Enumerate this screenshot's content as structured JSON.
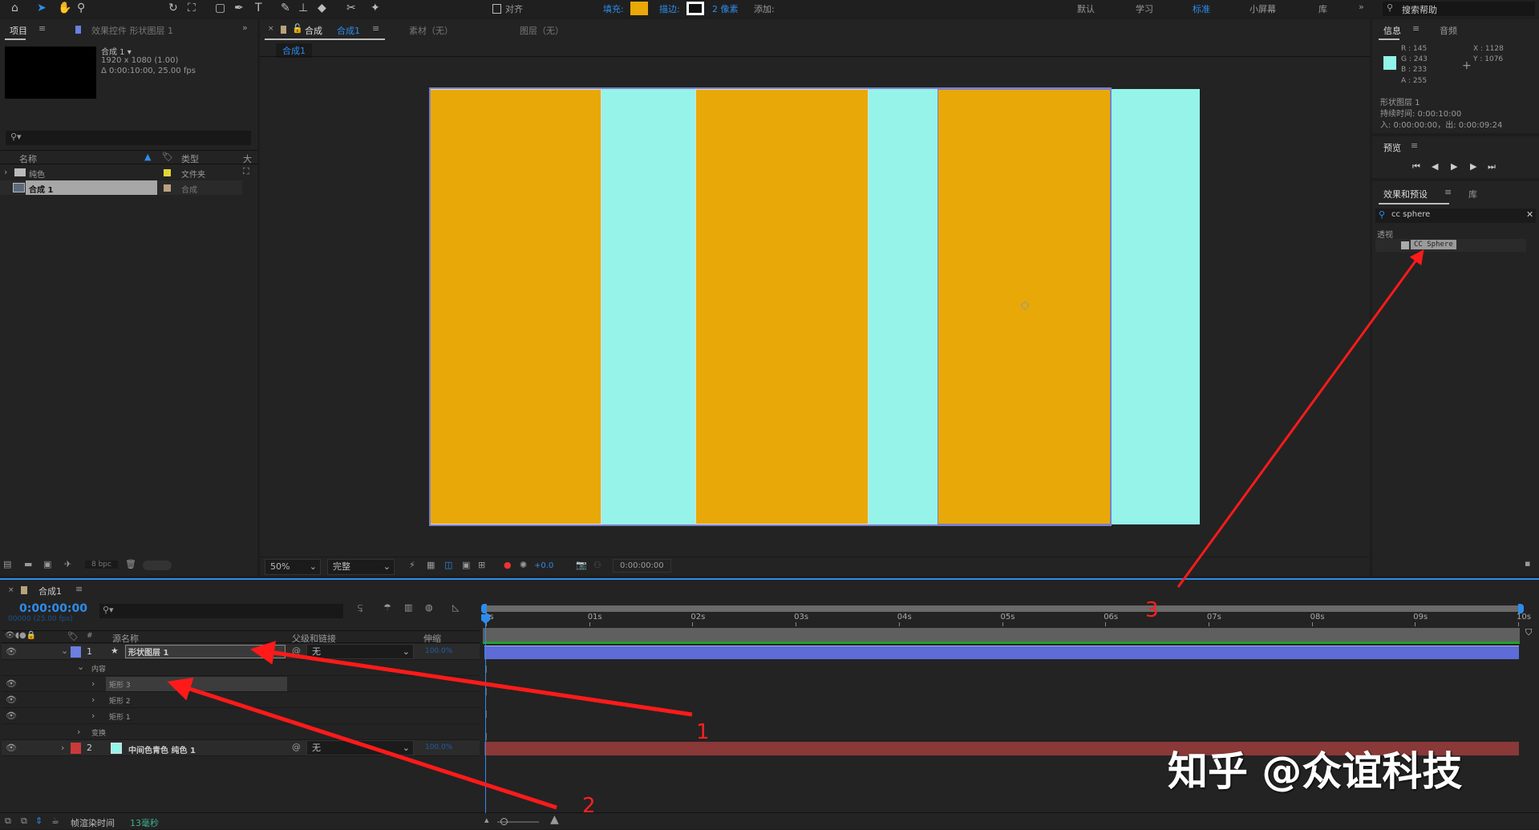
{
  "toolbar": {
    "align_label": "对齐",
    "fill_label": "填充:",
    "stroke_label": "描边:",
    "stroke_width": "2 像素",
    "add_label": "添加:",
    "fill_color": "#e8a807",
    "workspaces": [
      "默认",
      "学习",
      "标准",
      "小屏幕",
      "库"
    ],
    "active_workspace": "标准",
    "search_help": "搜索帮助"
  },
  "project": {
    "tab": "项目",
    "effects_tab": "效果控件 形状图层 1",
    "comp_name": "合成 1 ▾",
    "comp_res": "1920 x 1080 (1.00)",
    "comp_dur": "Δ 0:00:10:00, 25.00 fps",
    "col_name": "名称",
    "col_type": "类型",
    "col_size": "大",
    "items": [
      {
        "name": "纯色",
        "type": "文件夹",
        "label_color": "#e3d43a"
      },
      {
        "name": "合成 1",
        "type": "合成",
        "label_color": "#b9a27f"
      }
    ],
    "bpc": "8 bpc"
  },
  "viewer": {
    "tab_prefix": "合成",
    "tab_name": "合成1",
    "footage_tab": "素材（无）",
    "layer_tab": "图层（无）",
    "breadcrumb": "合成1",
    "zoom": "50%",
    "quality": "完整",
    "exposure": "+0.0",
    "timecode": "0:00:00:00",
    "colors": {
      "orange": "#e8a807",
      "cyan": "#95f3e9"
    }
  },
  "info": {
    "tab": "信息",
    "audio_tab": "音频",
    "r": "R : 145",
    "g": "G : 243",
    "b": "B : 233",
    "a": "A : 255",
    "x": "X : 1128",
    "y": "Y : 1076",
    "layer": "形状图层 1",
    "duration": "持续时间: 0:00:10:00",
    "inout": "入: 0:00:00:00，出: 0:00:09:24",
    "swatch": "#91f3e9"
  },
  "preview": {
    "tab": "预览"
  },
  "effects": {
    "tab": "效果和预设",
    "lib_tab": "库",
    "search": "cc sphere",
    "category": "透视",
    "result": "CC Sphere"
  },
  "timeline": {
    "tab": "合成1",
    "timecode": "0:00:00:00",
    "frames": "00000 (25.00 fps)",
    "col_source": "源名称",
    "col_parent": "父级和链接",
    "col_stretch": "伸缩",
    "layers": [
      {
        "num": "1",
        "name": "形状图层 1",
        "parent": "无",
        "stretch": "100.0%",
        "label_color": "#6c7ee0"
      },
      {
        "num": "2",
        "name": "中间色青色 纯色 1",
        "parent": "无",
        "stretch": "100.0%",
        "label_color": "#c93a3a"
      }
    ],
    "contents": "内容",
    "shapes": [
      "矩形 3",
      "矩形 2",
      "矩形 1"
    ],
    "transform": "变换",
    "ruler": [
      "0s",
      "01s",
      "02s",
      "03s",
      "04s",
      "05s",
      "06s",
      "07s",
      "08s",
      "09s",
      "10s"
    ],
    "render_label": "帧渲染时间",
    "render_time": "13毫秒"
  },
  "annotations": [
    "1",
    "2",
    "3"
  ],
  "watermark": "知乎 @众谊科技"
}
